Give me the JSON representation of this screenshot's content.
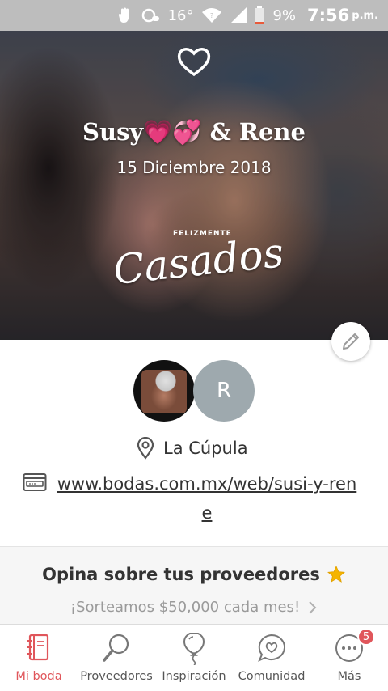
{
  "status_bar": {
    "temperature": "16°",
    "battery": "9%",
    "time": "7:56",
    "ampm": "p.m."
  },
  "hero": {
    "couple_names": "Susy💗💞 & Rene",
    "date": "15 Diciembre 2018",
    "sticker_small": "FELIZMENTE",
    "sticker_big": "Casados"
  },
  "profile": {
    "partner_initial": "R",
    "venue": "La Cúpula",
    "website": "www.bodas.com.mx/web/susi-y-rene"
  },
  "review_banner": {
    "title": "Opina sobre tus proveedores",
    "subtitle": "¡Sorteamos $50,000 cada mes!"
  },
  "bottom_nav": {
    "items": [
      {
        "label": "Mi boda",
        "icon": "notebook-icon",
        "active": true
      },
      {
        "label": "Proveedores",
        "icon": "magnifier-icon",
        "active": false
      },
      {
        "label": "Inspiración",
        "icon": "balloon-icon",
        "active": false
      },
      {
        "label": "Comunidad",
        "icon": "chat-heart-icon",
        "active": false
      },
      {
        "label": "Más",
        "icon": "more-dots-icon",
        "active": false,
        "badge": "5"
      }
    ]
  },
  "colors": {
    "accent": "#e0565b",
    "status_bar": "#bdbdbd",
    "star": "#f5b400",
    "avatar_gray": "#9ea9ae"
  }
}
